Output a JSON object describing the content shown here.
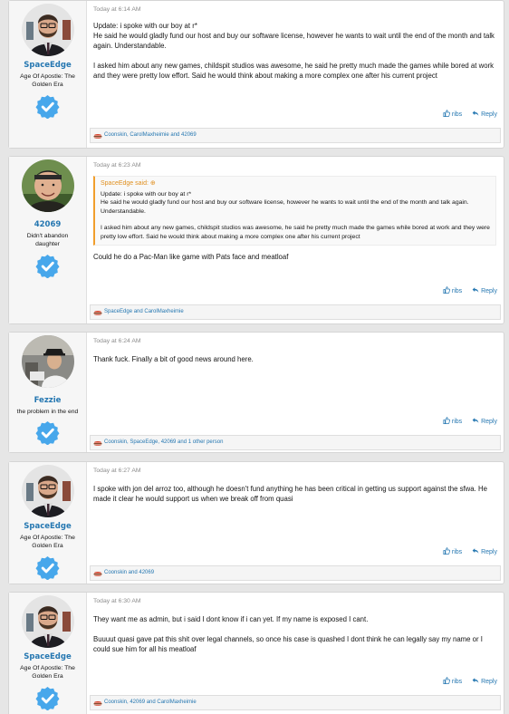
{
  "colors": {
    "link": "#2577b1",
    "quote_accent": "#f19e2c",
    "badge": "#47a7eb"
  },
  "icons": {
    "like": "thumbs-up-icon",
    "reply": "reply-arrow-icon",
    "likes_bar": "burger-like-icon",
    "verified": "verified-badge-icon",
    "quote_expand": "circle-arrow-icon"
  },
  "posts": [
    {
      "username": "SpaceEdge",
      "user_title": "Age Of Apostle: The Golden Era",
      "time": "Today at 6:14 AM",
      "paragraphs": [
        "Update: i spoke with our boy at r*\nHe said he would gladly fund our host and buy our software license, however he wants to wait until the end of the month and talk again. Understandable.",
        "I asked him about any new games, childspit studios was awesome, he said he pretty much made the games while bored at work and they were pretty low effort. Said he would think about making a more complex one after his current project"
      ],
      "like_label": "ribs",
      "reply_label": "Reply",
      "likes_text": "Coonskin, CarolMaxheimie and 42069"
    },
    {
      "username": "42069",
      "user_title": "Didn't abandon daughter",
      "time": "Today at 6:23 AM",
      "quote": {
        "author": "SpaceEdge said:",
        "expand": "⊕",
        "paragraphs": [
          "Update: i spoke with our boy at r*\nHe said he would gladly fund our host and buy our software license, however he wants to wait until the end of the month and talk again. Understandable.",
          "I asked him about any new games, childspit studios was awesome, he said he pretty much made the games while bored at work and they were pretty low effort. Said he would think about making a more complex one after his current project"
        ]
      },
      "paragraphs": [
        "Could he do a Pac-Man like game with Pats face and meatloaf"
      ],
      "like_label": "ribs",
      "reply_label": "Reply",
      "likes_text": "SpaceEdge and CarolMaxheimie"
    },
    {
      "username": "Fezzie",
      "user_title": "the problem in the end",
      "time": "Today at 6:24 AM",
      "paragraphs": [
        "Thank fuck. Finally a bit of good news around here."
      ],
      "like_label": "ribs",
      "reply_label": "Reply",
      "likes_text": "Coonskin, SpaceEdge, 42069 and 1 other person"
    },
    {
      "username": "SpaceEdge",
      "user_title": "Age Of Apostle: The Golden Era",
      "time": "Today at 6:27 AM",
      "paragraphs": [
        "I spoke with jon del arroz too, although he doesn't fund anything he has been critical in getting us support against the sfwa. He made it clear he would support us when we break off from quasi"
      ],
      "like_label": "ribs",
      "reply_label": "Reply",
      "likes_text": "Coonskin and 42069"
    },
    {
      "username": "SpaceEdge",
      "user_title": "Age Of Apostle: The Golden Era",
      "time": "Today at 6:30 AM",
      "paragraphs": [
        "They want me as admin, but i said I dont know if i can yet. If my name is exposed I cant.",
        "Buuuut quasi gave pat this shit over legal channels, so once his case is quashed I dont think he can legally say my name or I could sue him for all his meatloaf"
      ],
      "like_label": "ribs",
      "reply_label": "Reply",
      "likes_text": "Coonskin, 42069 and CarolMaxheimie"
    }
  ]
}
